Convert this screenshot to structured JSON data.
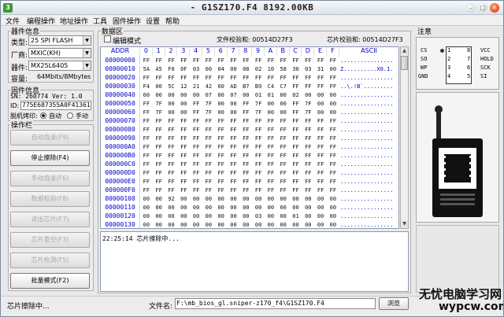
{
  "window": {
    "title": "- G1SZ170.F4   8192.00KB",
    "app_icon": "3"
  },
  "menu": [
    "文件",
    "编程操作",
    "地址操作",
    "工具",
    "固件操作",
    "设置",
    "帮助"
  ],
  "device_info": {
    "title": "器件信息",
    "type_label": "类型:",
    "type_value": "25 SPI FLASH",
    "vendor_label": "厂商:",
    "vendor_value": "MXIC(KH)",
    "device_label": "器件:",
    "device_value": "MX25L6405",
    "capacity_label": "容量:",
    "capacity_value": "64Mbits/8Mbytes"
  },
  "firmware_info": {
    "title": "固件信息",
    "sn": "SN: 260774   Ver: 1.0",
    "id_label": "ID:",
    "id_value": "775E687355A0F4136174",
    "offline_label": "脱机烤印:",
    "auto_label": "自动",
    "manual_label": "手动"
  },
  "operations": {
    "title": "操作栏",
    "buttons": [
      {
        "label": "自动烧录(F9)",
        "enabled": false
      },
      {
        "label": "停止擦除(F4)",
        "enabled": true
      },
      {
        "label": "手动烧录(F6)",
        "enabled": false
      },
      {
        "label": "数据校验(F8)",
        "enabled": false
      },
      {
        "label": "读出芯片(F7)",
        "enabled": false
      },
      {
        "label": "芯片查空(F3)",
        "enabled": false
      },
      {
        "label": "芯片检测(F5)",
        "enabled": false
      },
      {
        "label": "批量模式(F2)",
        "enabled": true
      }
    ]
  },
  "data_area": {
    "title": "数据区",
    "edit_mode": "编辑模式",
    "file_checksum": "文件校验和: 00514D27F3",
    "chip_checksum": "芯片校验和: 00514D27F3",
    "headers": [
      "ADDR",
      "0",
      "1",
      "2",
      "3",
      "4",
      "5",
      "6",
      "7",
      "8",
      "9",
      "A",
      "B",
      "C",
      "D",
      "E",
      "F",
      "ASCII"
    ],
    "rows": [
      {
        "addr": "00000000",
        "bytes": [
          "FF",
          "FF",
          "FF",
          "FF",
          "FF",
          "FF",
          "FF",
          "FF",
          "FF",
          "FF",
          "FF",
          "FF",
          "FF",
          "FF",
          "FF",
          "FF"
        ],
        "ascii": "................"
      },
      {
        "addr": "00000010",
        "bytes": [
          "5A",
          "A5",
          "F0",
          "0F",
          "03",
          "00",
          "04",
          "00",
          "08",
          "02",
          "10",
          "58",
          "30",
          "03",
          "31",
          "00"
        ],
        "ascii": "Z..........X0.1."
      },
      {
        "addr": "00000020",
        "bytes": [
          "FF",
          "FF",
          "FF",
          "FF",
          "FF",
          "FF",
          "FF",
          "FF",
          "FF",
          "FF",
          "FF",
          "FF",
          "FF",
          "FF",
          "FF",
          "FF"
        ],
        "ascii": "................"
      },
      {
        "addr": "00000030",
        "bytes": [
          "F4",
          "00",
          "5C",
          "12",
          "21",
          "42",
          "60",
          "AD",
          "B7",
          "B9",
          "C4",
          "C7",
          "FF",
          "FF",
          "FF",
          "FF"
        ],
        "ascii": "..\\.!B`........."
      },
      {
        "addr": "00000040",
        "bytes": [
          "00",
          "00",
          "00",
          "00",
          "00",
          "07",
          "00",
          "07",
          "00",
          "01",
          "01",
          "00",
          "02",
          "00",
          "00",
          "00"
        ],
        "ascii": "................"
      },
      {
        "addr": "00000050",
        "bytes": [
          "FF",
          "7F",
          "00",
          "00",
          "FF",
          "7F",
          "00",
          "00",
          "FF",
          "7F",
          "00",
          "00",
          "FF",
          "7F",
          "00",
          "00"
        ],
        "ascii": "................"
      },
      {
        "addr": "00000060",
        "bytes": [
          "FF",
          "7F",
          "00",
          "00",
          "FF",
          "7F",
          "00",
          "00",
          "FF",
          "7F",
          "00",
          "00",
          "FF",
          "7F",
          "00",
          "00"
        ],
        "ascii": "................"
      },
      {
        "addr": "00000070",
        "bytes": [
          "FF",
          "FF",
          "FF",
          "FF",
          "FF",
          "FF",
          "FF",
          "FF",
          "FF",
          "FF",
          "FF",
          "FF",
          "FF",
          "FF",
          "FF",
          "FF"
        ],
        "ascii": "................"
      },
      {
        "addr": "00000080",
        "bytes": [
          "FF",
          "FF",
          "FF",
          "FF",
          "FF",
          "FF",
          "FF",
          "FF",
          "FF",
          "FF",
          "FF",
          "FF",
          "FF",
          "FF",
          "FF",
          "FF"
        ],
        "ascii": "................"
      },
      {
        "addr": "00000090",
        "bytes": [
          "FF",
          "FF",
          "FF",
          "FF",
          "FF",
          "FF",
          "FF",
          "FF",
          "FF",
          "FF",
          "FF",
          "FF",
          "FF",
          "FF",
          "FF",
          "FF"
        ],
        "ascii": "................"
      },
      {
        "addr": "000000A0",
        "bytes": [
          "FF",
          "FF",
          "FF",
          "FF",
          "FF",
          "FF",
          "FF",
          "FF",
          "FF",
          "FF",
          "FF",
          "FF",
          "FF",
          "FF",
          "FF",
          "FF"
        ],
        "ascii": "................"
      },
      {
        "addr": "000000B0",
        "bytes": [
          "FF",
          "FF",
          "FF",
          "FF",
          "FF",
          "FF",
          "FF",
          "FF",
          "FF",
          "FF",
          "FF",
          "FF",
          "FF",
          "FF",
          "FF",
          "FF"
        ],
        "ascii": "................"
      },
      {
        "addr": "000000C0",
        "bytes": [
          "FF",
          "FF",
          "FF",
          "FF",
          "FF",
          "FF",
          "FF",
          "FF",
          "FF",
          "FF",
          "FF",
          "FF",
          "FF",
          "FF",
          "FF",
          "FF"
        ],
        "ascii": "................"
      },
      {
        "addr": "000000D0",
        "bytes": [
          "FF",
          "FF",
          "FF",
          "FF",
          "FF",
          "FF",
          "FF",
          "FF",
          "FF",
          "FF",
          "FF",
          "FF",
          "FF",
          "FF",
          "FF",
          "FF"
        ],
        "ascii": "................"
      },
      {
        "addr": "000000E0",
        "bytes": [
          "FF",
          "FF",
          "FF",
          "FF",
          "FF",
          "FF",
          "FF",
          "FF",
          "FF",
          "FF",
          "FF",
          "FF",
          "FF",
          "FF",
          "FF",
          "FF"
        ],
        "ascii": "................"
      },
      {
        "addr": "000000F0",
        "bytes": [
          "FF",
          "FF",
          "FF",
          "FF",
          "FF",
          "FF",
          "FF",
          "FF",
          "FF",
          "FF",
          "FF",
          "FF",
          "FF",
          "FF",
          "FF",
          "FF"
        ],
        "ascii": "................"
      },
      {
        "addr": "00000100",
        "bytes": [
          "00",
          "00",
          "92",
          "00",
          "00",
          "00",
          "00",
          "00",
          "00",
          "00",
          "00",
          "00",
          "00",
          "00",
          "00",
          "00"
        ],
        "ascii": "................"
      },
      {
        "addr": "00000110",
        "bytes": [
          "00",
          "00",
          "00",
          "00",
          "00",
          "00",
          "00",
          "00",
          "00",
          "00",
          "00",
          "00",
          "00",
          "00",
          "00",
          "00"
        ],
        "ascii": "................"
      },
      {
        "addr": "00000120",
        "bytes": [
          "00",
          "00",
          "00",
          "00",
          "00",
          "00",
          "00",
          "00",
          "00",
          "03",
          "00",
          "00",
          "01",
          "00",
          "00",
          "00"
        ],
        "ascii": "................"
      },
      {
        "addr": "00000130",
        "bytes": [
          "00",
          "00",
          "00",
          "00",
          "00",
          "00",
          "00",
          "00",
          "00",
          "00",
          "00",
          "00",
          "00",
          "00",
          "00",
          "00"
        ],
        "ascii": "................"
      }
    ]
  },
  "log": {
    "line": "22:25:14   芯片擦除中..."
  },
  "note": {
    "title": "注意",
    "pins_left": [
      {
        "name": "CS",
        "num": "1"
      },
      {
        "name": "SO",
        "num": "2"
      },
      {
        "name": "WP",
        "num": "3"
      },
      {
        "name": "GND",
        "num": "4"
      }
    ],
    "pins_right": [
      {
        "num": "8",
        "name": "VCC"
      },
      {
        "num": "7",
        "name": "HOLD"
      },
      {
        "num": "6",
        "name": "SCK"
      },
      {
        "num": "5",
        "name": "SI"
      }
    ]
  },
  "status": {
    "text": "芯片擦除中..."
  },
  "file": {
    "label": "文件名:",
    "value": "F:\\mb_bios_gl.sniper-z170_f4\\G1SZ170.F4",
    "browse": "浏览"
  },
  "watermark": {
    "line1": "无忧电脑学习网",
    "line2": "wypcw.com"
  }
}
